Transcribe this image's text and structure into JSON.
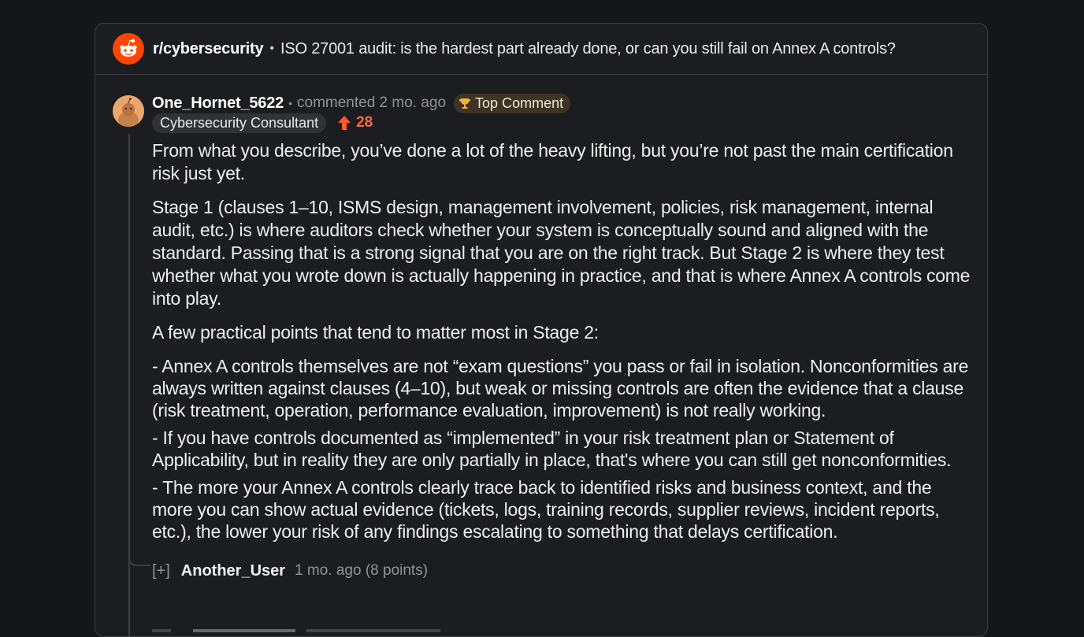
{
  "header": {
    "subreddit": "r/cybersecurity",
    "separator": "•",
    "post_title": "ISO 27001 audit: is the hardest part already done, or can you still fail on Annex A controls?"
  },
  "comment": {
    "username": "One_Hornet_5622",
    "separator": "•",
    "timestamp": "commented 2 mo. ago",
    "badge": "Top Comment",
    "flair": "Cybersecurity Consultant",
    "score": "28",
    "paragraphs": [
      "From what you describe, you’ve done a lot of the heavy lifting, but you’re not past the main certification risk just yet.",
      "Stage 1 (clauses 1–10, ISMS design, management involvement, policies, risk management, internal audit, etc.) is where auditors check whether your system is conceptually sound and aligned with the standard. Passing that is a strong signal that you are on the right track. But Stage 2 is where they test whether what you wrote down is actually happening in practice, and that is where Annex A controls come into play.",
      "A few practical points that tend to matter most in Stage 2:"
    ],
    "bullets": [
      "- Annex A controls themselves are not “exam questions” you pass or fail in isolation. Nonconformities are always written against clauses (4–10), but weak or missing controls are often the evidence that a clause (risk treatment, operation, performance evaluation, improvement) is not really working.",
      "- If you have controls documented as “implemented” in your risk treatment plan or Statement of Applicability, but in reality they are only partially in place, that's where you can still get nonconformities.",
      "- The more your Annex A controls clearly trace back to identified risks and business context, and the more you can show actual evidence (tickets, logs, training records, supplier reviews, incident reports, etc.), the lower your risk of any findings escalating to something that delays certification."
    ]
  },
  "replies": [
    {
      "expander": "[+]",
      "username": "Another_User",
      "meta": "1 mo. ago (8 points)"
    }
  ],
  "colors": {
    "background": "#141618",
    "card": "#1b1d20",
    "brand_orange": "#ff4500",
    "upvote": "#ff6a3d",
    "badge_bg": "#3f3423",
    "flair_bg": "#303235"
  },
  "icons": {
    "logo": "reddit-logo-icon",
    "avatar": "reddit-avatar-icon",
    "badge": "trophy-icon",
    "score": "upvote-arrow-icon"
  }
}
